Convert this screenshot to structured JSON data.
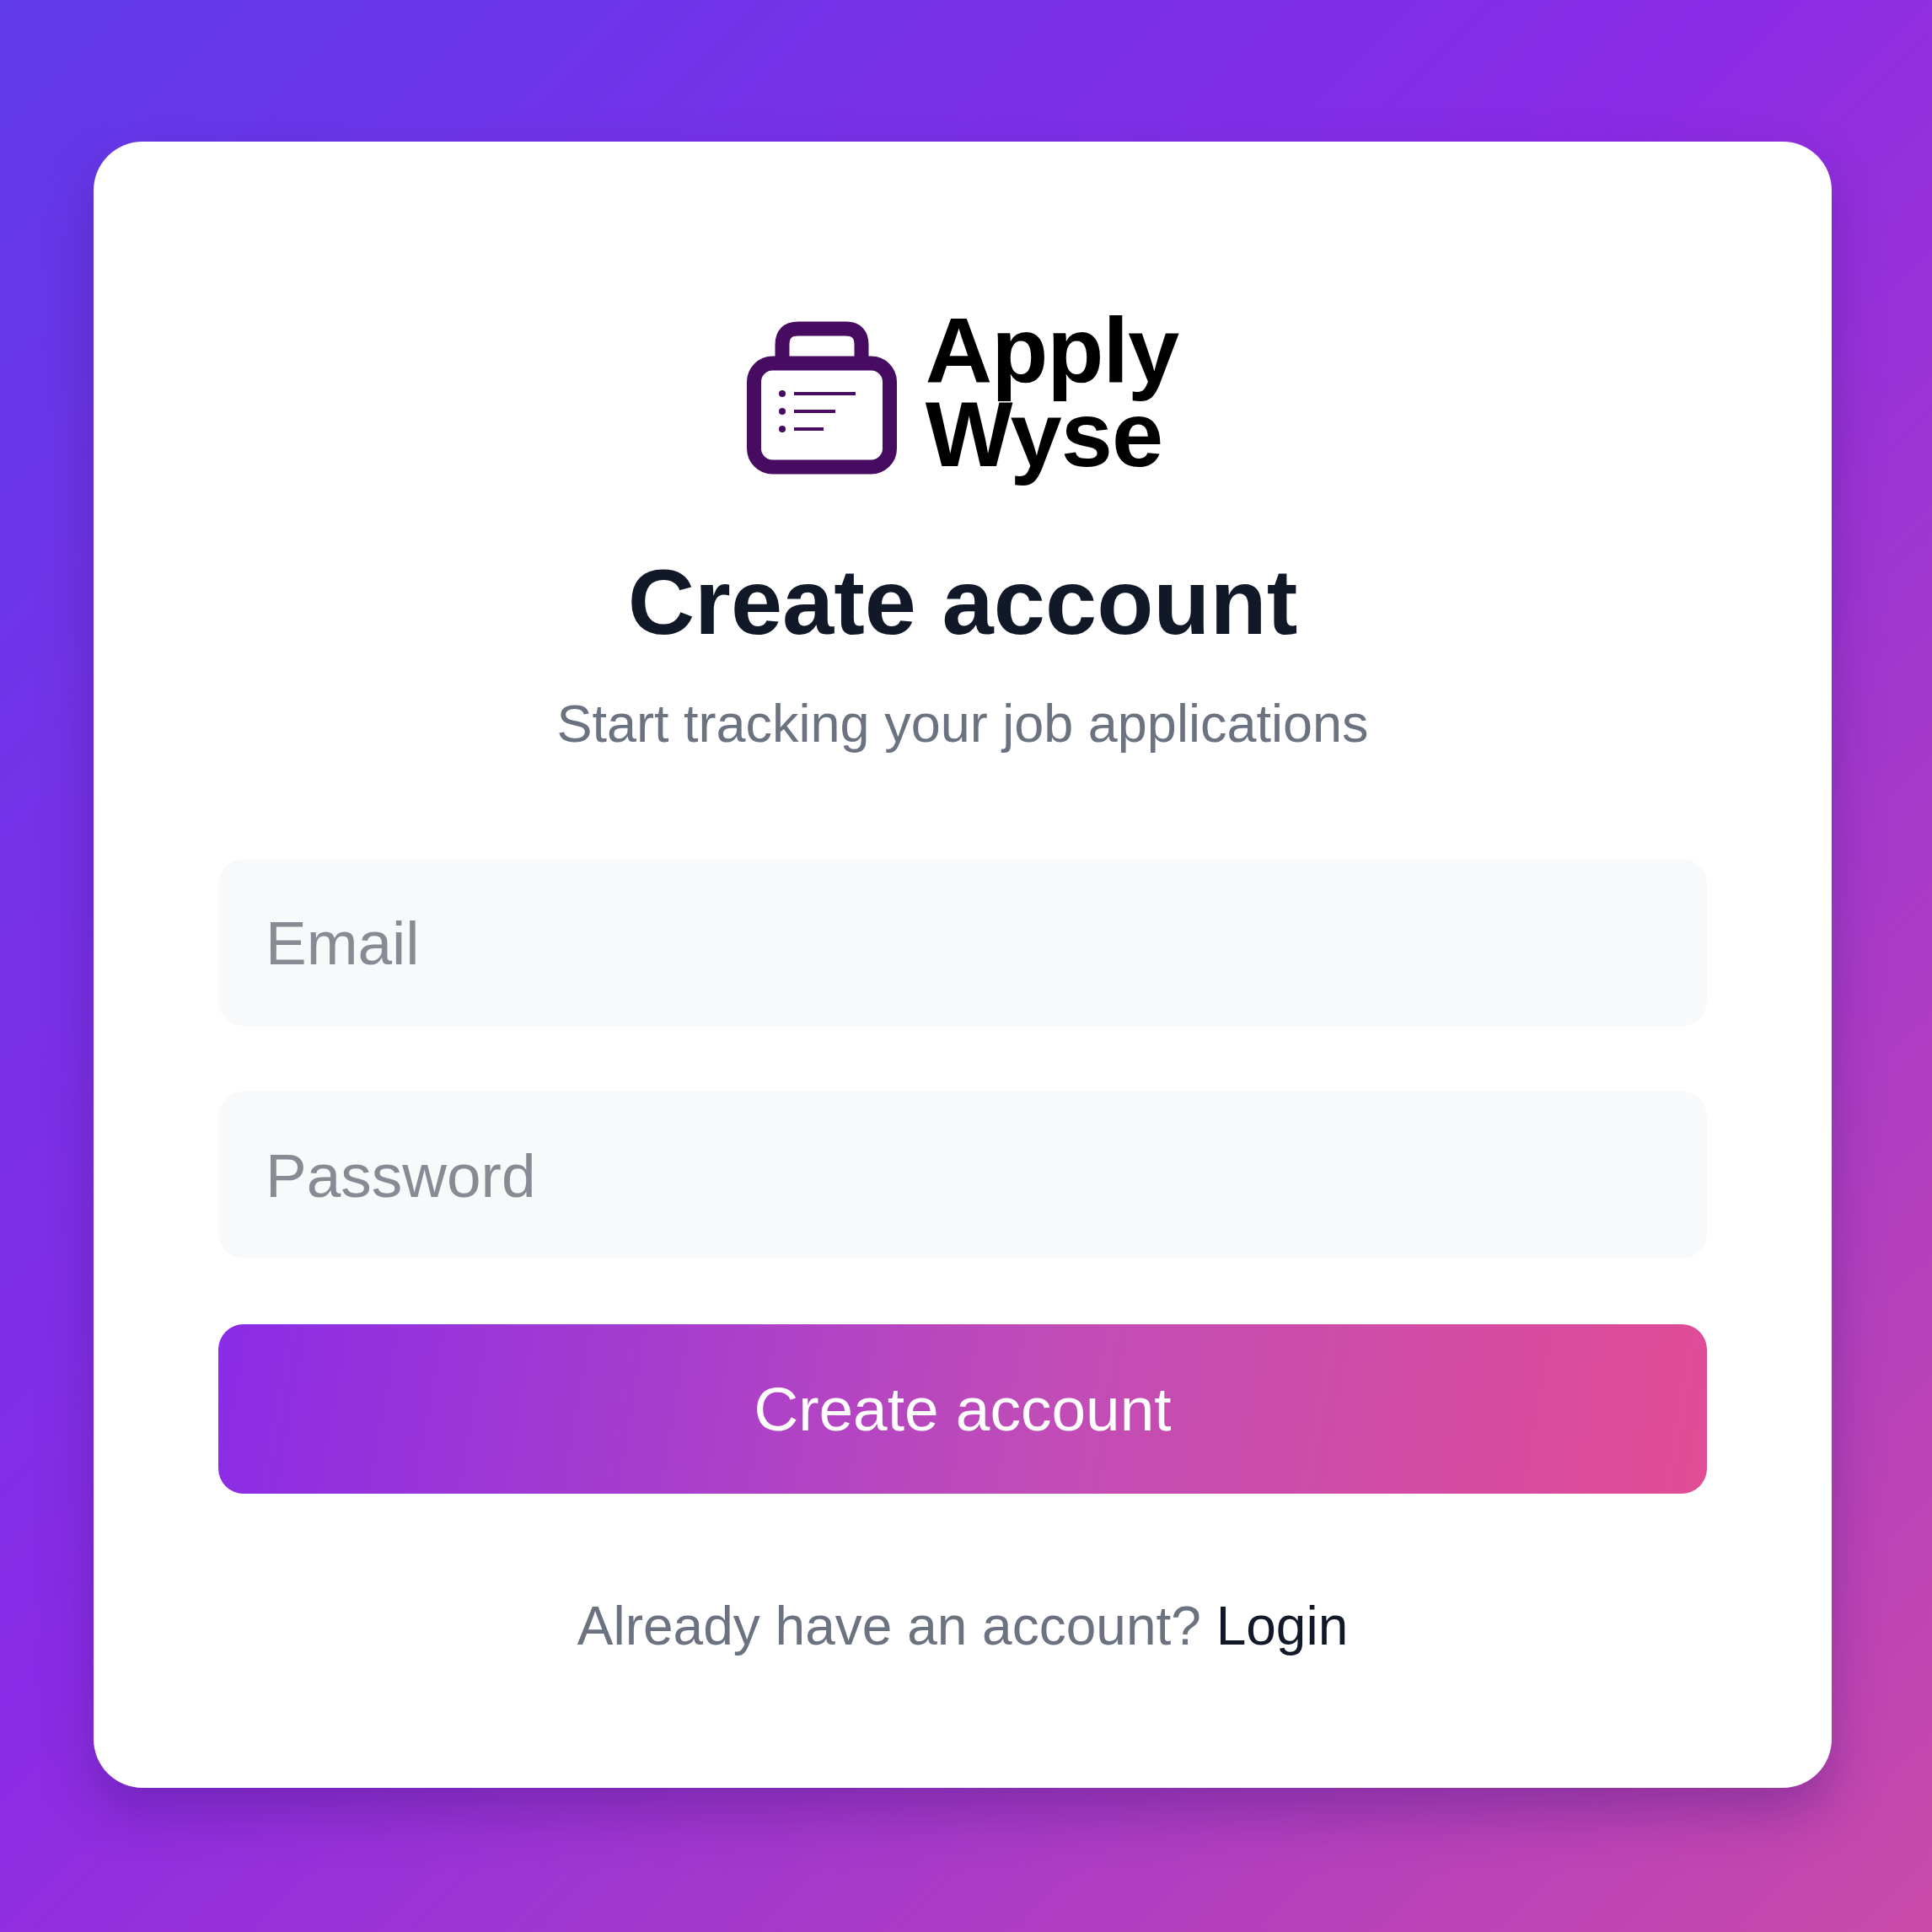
{
  "logo": {
    "wordmark": "Apply Wyse"
  },
  "title": "Create account",
  "subtitle": "Start tracking your job applications",
  "fields": [
    {
      "placeholder": "Email"
    },
    {
      "placeholder": "Password"
    }
  ],
  "submit_button": "Create account",
  "footer": {
    "prompt": "Already have an account?",
    "link": "Login"
  }
}
